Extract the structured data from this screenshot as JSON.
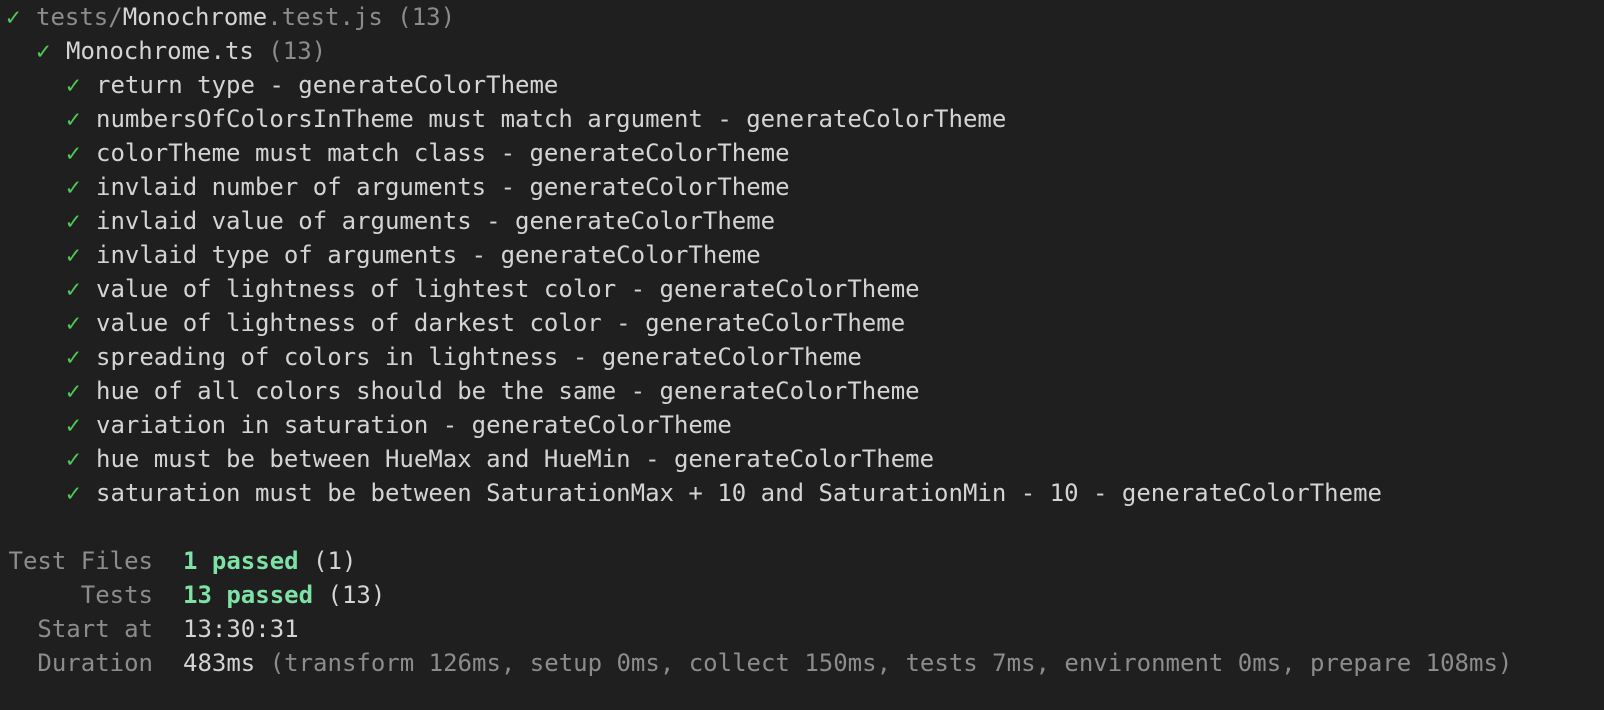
{
  "suite": {
    "file_dir": "tests/",
    "file_name": "Monochrome",
    "file_ext": ".test.js",
    "file_count": "(13)",
    "group_name": "Monochrome.ts",
    "group_count": "(13)"
  },
  "tests": [
    "return type - generateColorTheme",
    "numbersOfColorsInTheme must match argument - generateColorTheme",
    "colorTheme must match class - generateColorTheme",
    "invlaid number of arguments - generateColorTheme",
    "invlaid value of arguments - generateColorTheme",
    "invlaid type of arguments - generateColorTheme",
    "value of lightness of lightest color - generateColorTheme",
    "value of lightness of darkest color - generateColorTheme",
    "spreading of colors in lightness - generateColorTheme",
    "hue of all colors should be the same - generateColorTheme",
    "variation in saturation - generateColorTheme",
    "hue must be between HueMax and HueMin - generateColorTheme",
    "saturation must be between SaturationMax + 10 and SaturationMin - 10 - generateColorTheme"
  ],
  "check_glyph": "✓",
  "summary": {
    "test_files": {
      "label": "Test Files",
      "passed": "1 passed",
      "total": "(1)"
    },
    "tests": {
      "label": "Tests",
      "passed": "13 passed",
      "total": "(13)"
    },
    "start_at": {
      "label": "Start at",
      "value": "13:30:31"
    },
    "duration": {
      "label": "Duration",
      "value": "483ms",
      "detail": "(transform 126ms, setup 0ms, collect 150ms, tests 7ms, environment 0ms, prepare 108ms)"
    }
  },
  "colors": {
    "background": "#1f1f1f",
    "check": "#4ec957",
    "pass": "#7ee2a6",
    "dim": "#8c8c8c",
    "text": "#d4d4d4"
  }
}
